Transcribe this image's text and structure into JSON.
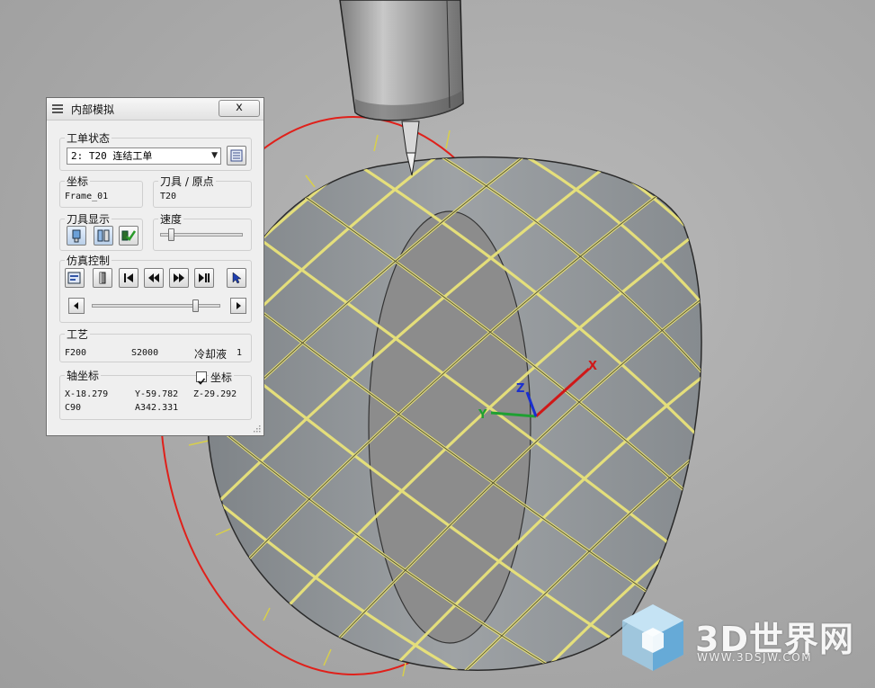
{
  "dialog": {
    "title": "内部模拟",
    "close_label": "x",
    "work_order_status": {
      "label": "工单状态",
      "selected": "2: T20 连结工单"
    },
    "coordinate": {
      "label": "坐标",
      "value": "Frame_01"
    },
    "tool_origin": {
      "label": "刀具 / 原点",
      "value": "T20"
    },
    "tool_display": {
      "label": "刀具显示"
    },
    "speed": {
      "label": "速度",
      "value_fraction": 0.1
    },
    "sim_control": {
      "label": "仿真控制",
      "progress_fraction": 0.82
    },
    "process": {
      "label": "工艺",
      "feed": "F200",
      "spindle": "S2000",
      "coolant_label": "冷却液",
      "coolant_value": "1"
    },
    "axis_coords": {
      "label": "轴坐标",
      "checkbox_label": "坐标",
      "checked": true,
      "x": "X-18.279",
      "y": "Y-59.782",
      "z": "Z-29.292",
      "c": "C90",
      "a": "A342.331"
    }
  },
  "triad": {
    "x_label": "X",
    "y_label": "Y",
    "z_label": "Z"
  },
  "watermark": {
    "brand": "3D世界网",
    "url": "WWW.3DSJW.COM"
  },
  "colors": {
    "toolpath": "#e9e37a",
    "rotary_circle": "#e0201a",
    "x_axis": "#d01818",
    "y_axis": "#1fa032",
    "z_axis": "#1a2fd0"
  }
}
